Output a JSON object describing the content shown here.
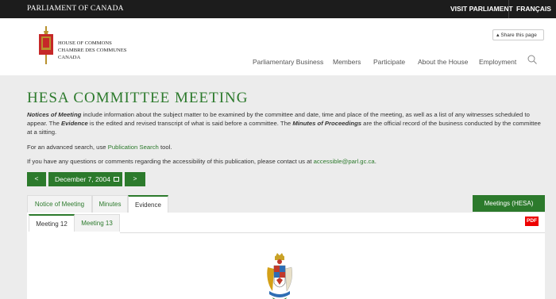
{
  "topbar": {
    "parliament_label": "PARLIAMENT OF CANADA",
    "visit_label": "VISIT PARLIAMENT",
    "language_label": "FRANÇAIS"
  },
  "header": {
    "house_line1": "HOUSE OF COMMONS",
    "house_line2": "CHAMBRE DES COMMUNES",
    "house_line3": "CANADA",
    "share_label": "Share this page",
    "nav": {
      "business": "Parliamentary Business",
      "members": "Members",
      "participate": "Participate",
      "about": "About the House",
      "employment": "Employment"
    }
  },
  "main": {
    "title": "HESA COMMITTEE MEETING",
    "intro": {
      "notices_term": "Notices of Meeting",
      "notices_text": " include information about the subject matter to be examined by the committee and date, time and place of the meeting, as well as a list of any witnesses scheduled to appear. The ",
      "evidence_term": "Evidence",
      "evidence_text": " is the edited and revised transcript of what is said before a committee. The ",
      "minutes_term": "Minutes of Proceedings",
      "minutes_text": " are the official record of the business conducted by the committee at a sitting."
    },
    "advanced_prefix": "For an advanced search, use ",
    "advanced_link": "Publication Search",
    "advanced_suffix": " tool.",
    "access_prefix": "If you have any questions or comments regarding the accessibility of this publication, please contact us at ",
    "access_link": "accessible@parl.gc.ca",
    "access_suffix": ".",
    "date_nav": {
      "prev": "<",
      "date": "December 7, 2004",
      "next": ">"
    },
    "tabs": {
      "notice": "Notice of Meeting",
      "minutes": "Minutes",
      "evidence": "Evidence"
    },
    "meetings_button": "Meetings (HESA)",
    "subtabs": {
      "meeting12": "Meeting 12",
      "meeting13": "Meeting 13"
    },
    "pdf_label": "PDF"
  },
  "colors": {
    "accent": "#2c7a2c",
    "topbar": "#1c1c1c",
    "pdf": "#e00000"
  }
}
